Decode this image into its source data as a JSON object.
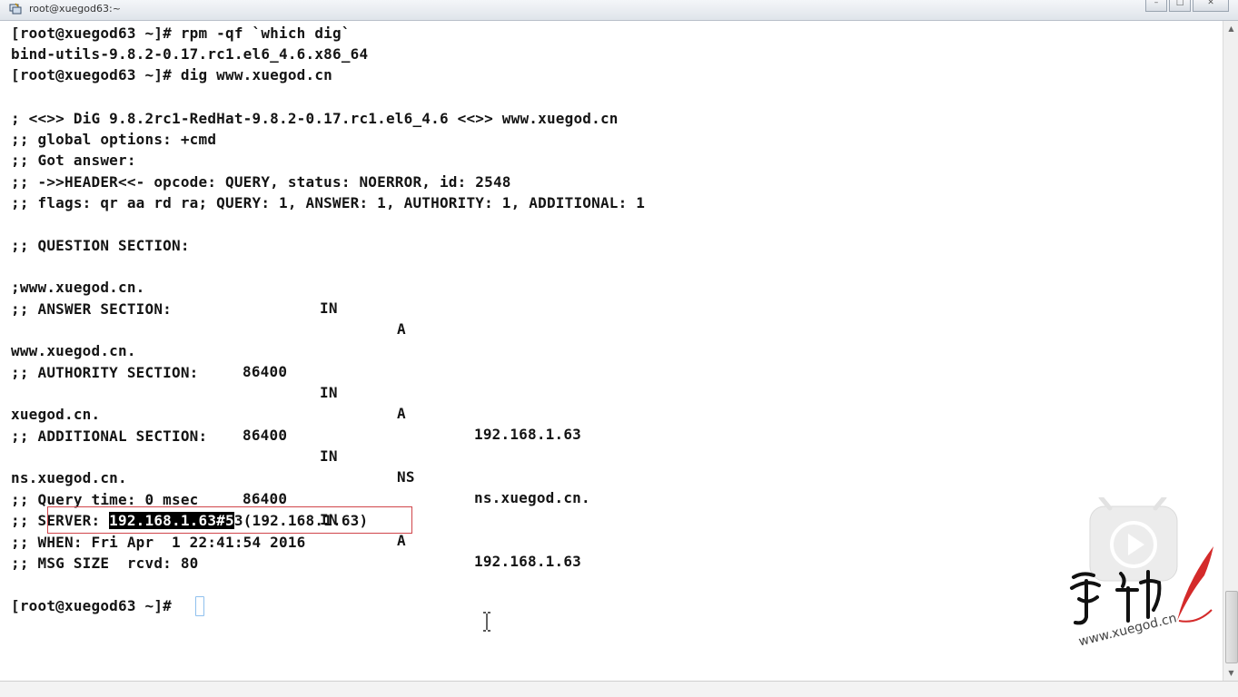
{
  "window": {
    "title": "root@xuegod63:~"
  },
  "terminal": {
    "lines": [
      "[root@xuegod63 ~]# rpm -qf `which dig`",
      "bind-utils-9.8.2-0.17.rc1.el6_4.6.x86_64",
      "[root@xuegod63 ~]# dig www.xuegod.cn",
      "",
      "; <<>> DiG 9.8.2rc1-RedHat-9.8.2-0.17.rc1.el6_4.6 <<>> www.xuegod.cn",
      ";; global options: +cmd",
      ";; Got answer:",
      ";; ->>HEADER<<- opcode: QUERY, status: NOERROR, id: 2548",
      ";; flags: qr aa rd ra; QUERY: 1, ANSWER: 1, AUTHORITY: 1, ADDITIONAL: 1",
      "",
      ";; QUESTION SECTION:",
      "",
      "",
      ";; ANSWER SECTION:",
      "",
      "",
      ";; AUTHORITY SECTION:",
      "",
      "",
      ";; ADDITIONAL SECTION:",
      "",
      "",
      ";; Query time: 0 msec",
      "",
      ";; WHEN: Fri Apr  1 22:41:54 2016",
      ";; MSG SIZE  rcvd: 80",
      "",
      "[root@xuegod63 ~]# "
    ],
    "question_row": {
      "name": ";www.xuegod.cn.",
      "class": "IN",
      "type": "A"
    },
    "answer_row": {
      "name": "www.xuegod.cn.",
      "ttl": "86400",
      "class": "IN",
      "type": "A",
      "data": "192.168.1.63"
    },
    "authority_row": {
      "name": "xuegod.cn.",
      "ttl": "86400",
      "class": "IN",
      "type": "NS",
      "data": "ns.xuegod.cn."
    },
    "additional_row": {
      "name": "ns.xuegod.cn.",
      "ttl": "86400",
      "class": "IN",
      "type": "A",
      "data": "192.168.1.63"
    },
    "server_line": {
      "prefix": ";; SERVER: ",
      "selected": "192.168.1.63#5",
      "rest": "3(192.168.1.63)"
    }
  },
  "watermark": {
    "url": "www.xuegod.cn"
  },
  "colors": {
    "highlight_box": "#d0454a",
    "cursor": "#8fc0ee",
    "watermark_red": "#d42a2a"
  }
}
